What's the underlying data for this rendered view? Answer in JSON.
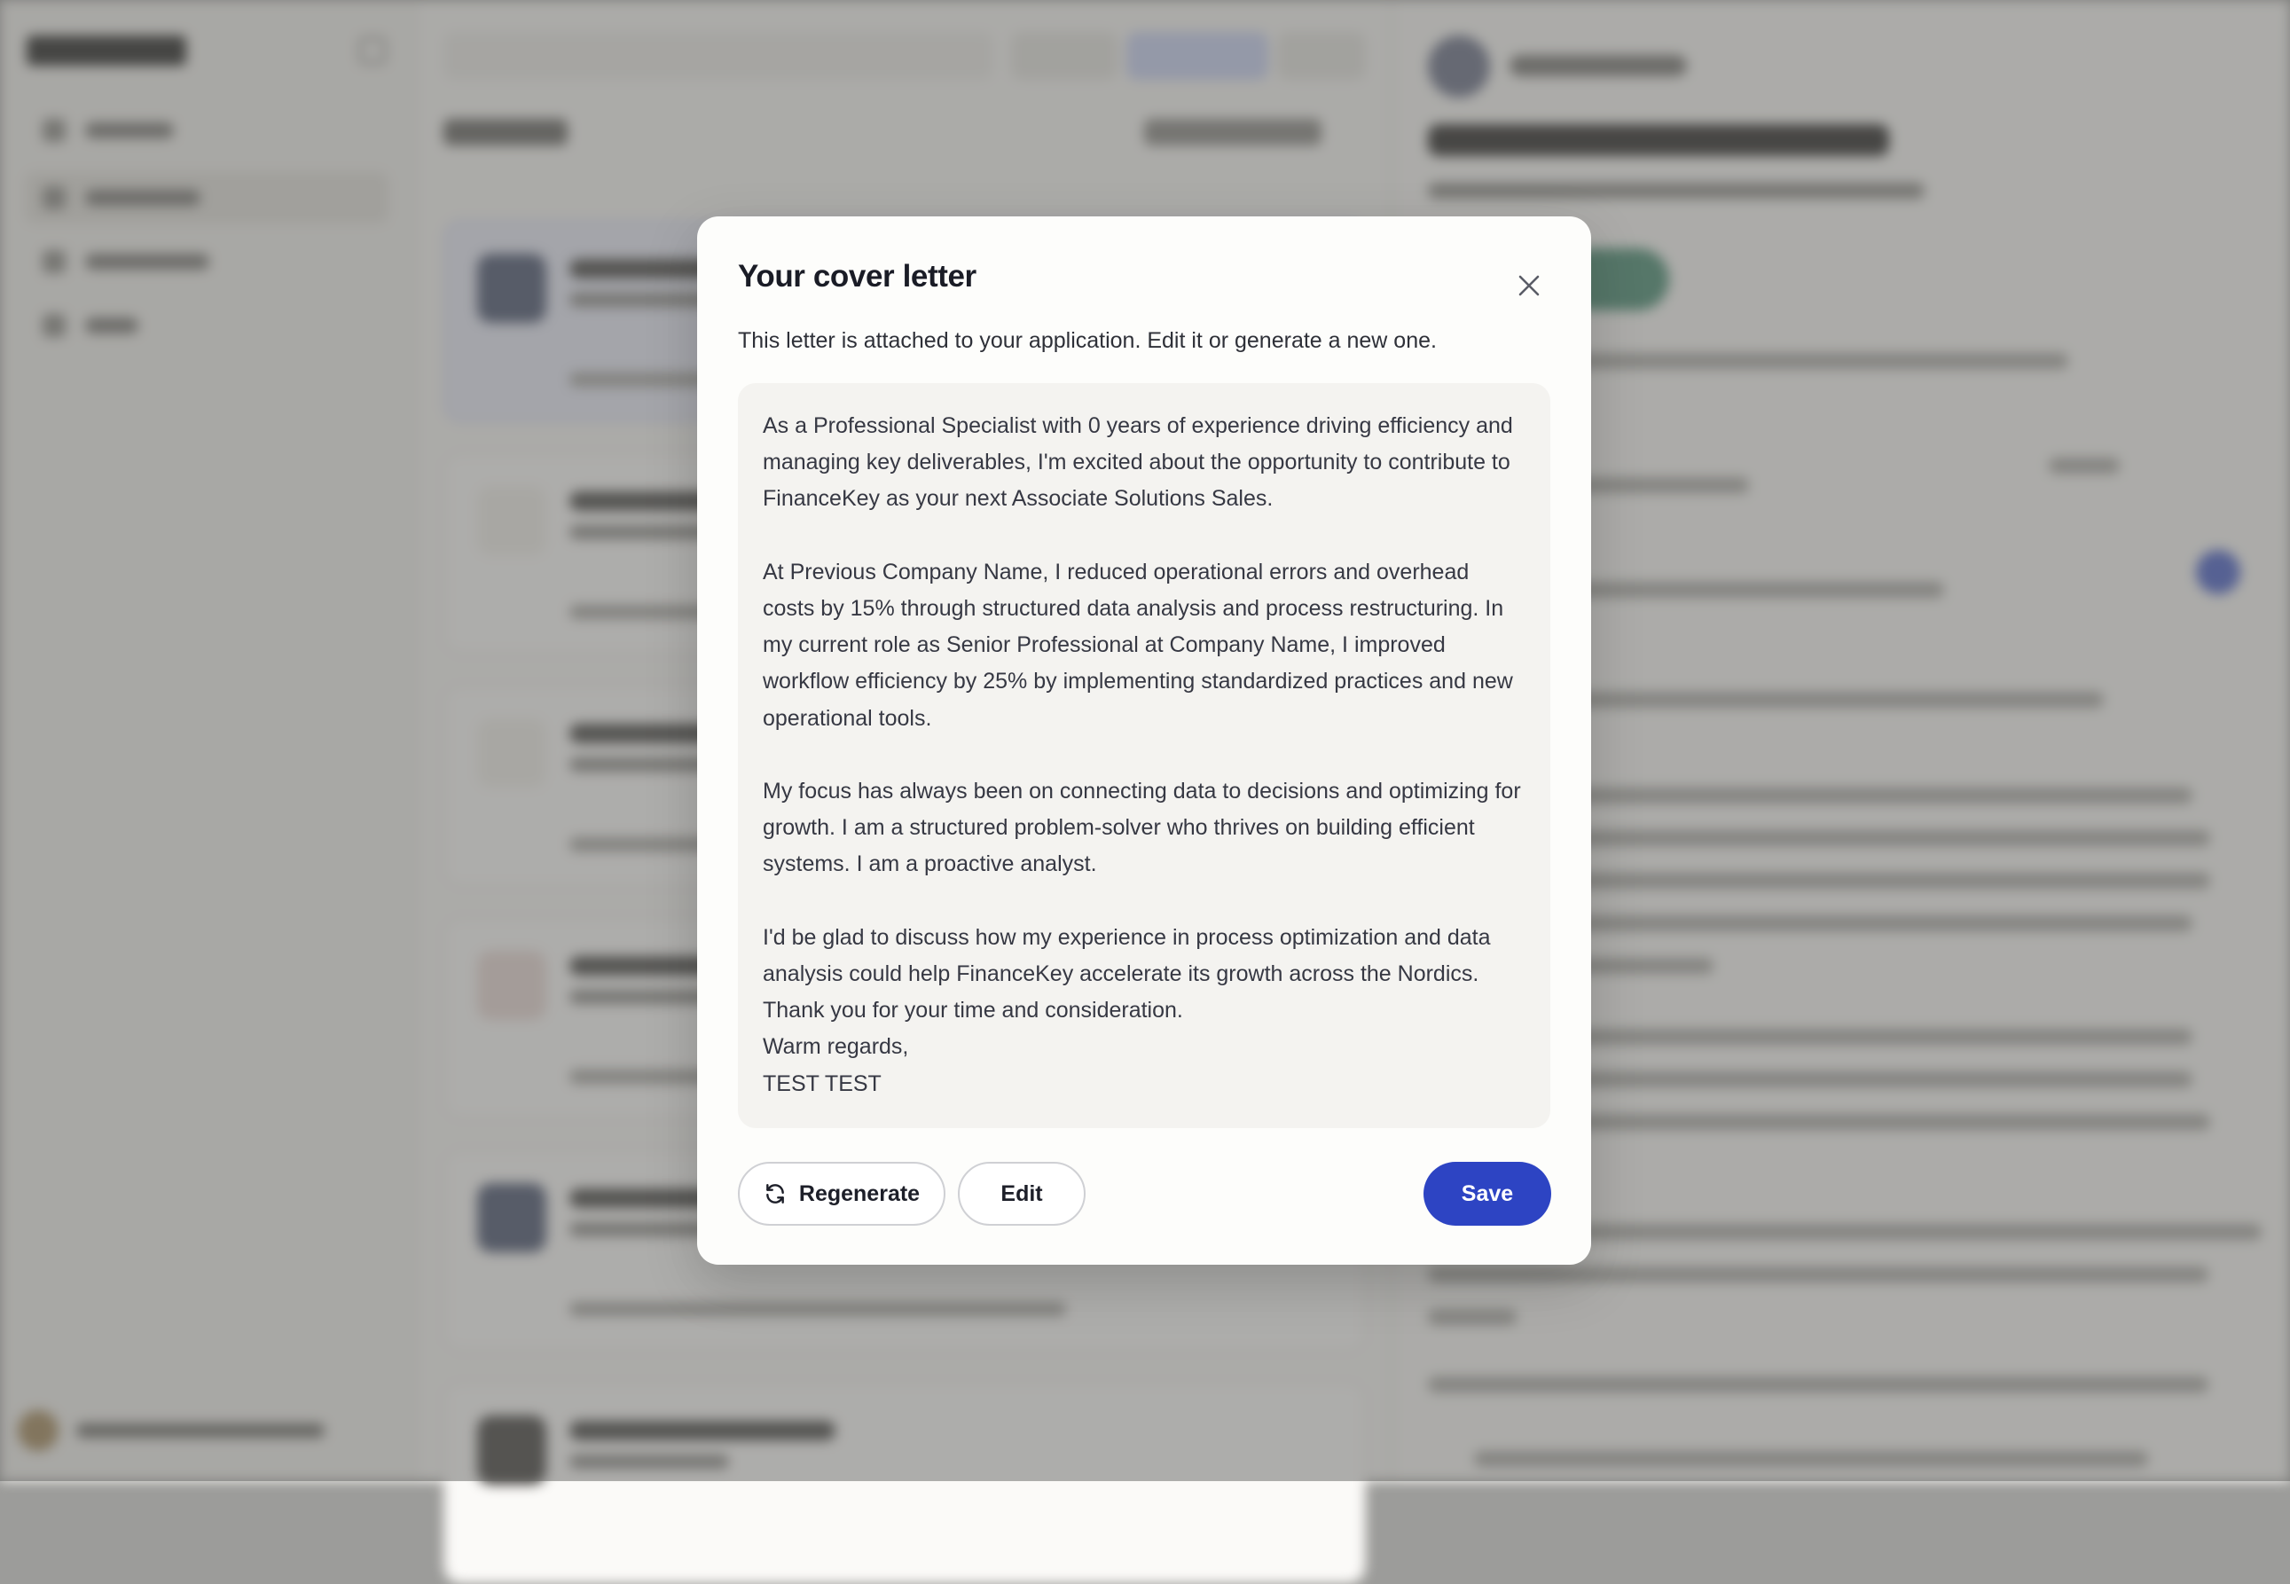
{
  "modal": {
    "title": "Your cover letter",
    "subtitle": "This letter is attached to your application. Edit it or generate a new one.",
    "letter": "As a Professional Specialist with 0 years of experience driving efficiency and managing key deliverables, I'm excited about the opportunity to contribute to FinanceKey as your next Associate Solutions Sales.\n\nAt Previous Company Name, I reduced operational errors and overhead costs by 15% through structured data analysis and process restructuring. In my current role as Senior Professional at Company Name, I improved workflow efficiency by 25% by implementing standardized practices and new operational tools.\n\nMy focus has always been on connecting data to decisions and optimizing for growth. I am a structured problem-solver who thrives on building efficient systems. I am a proactive analyst.\n\nI'd be glad to discuss how my experience in process optimization and data analysis could help FinanceKey accelerate its growth across the Nordics.\nThank you for your time and consideration.\nWarm regards,\nTEST TEST",
    "buttons": {
      "regenerate": "Regenerate",
      "edit": "Edit",
      "save": "Save"
    },
    "icons": {
      "close": "close-icon",
      "regenerate": "refresh-icon"
    }
  },
  "colors": {
    "primary": "#2d44c3",
    "overlay": "#60605e",
    "modal_bg": "#fdfdfb",
    "letter_bg": "#f4f3f0"
  }
}
